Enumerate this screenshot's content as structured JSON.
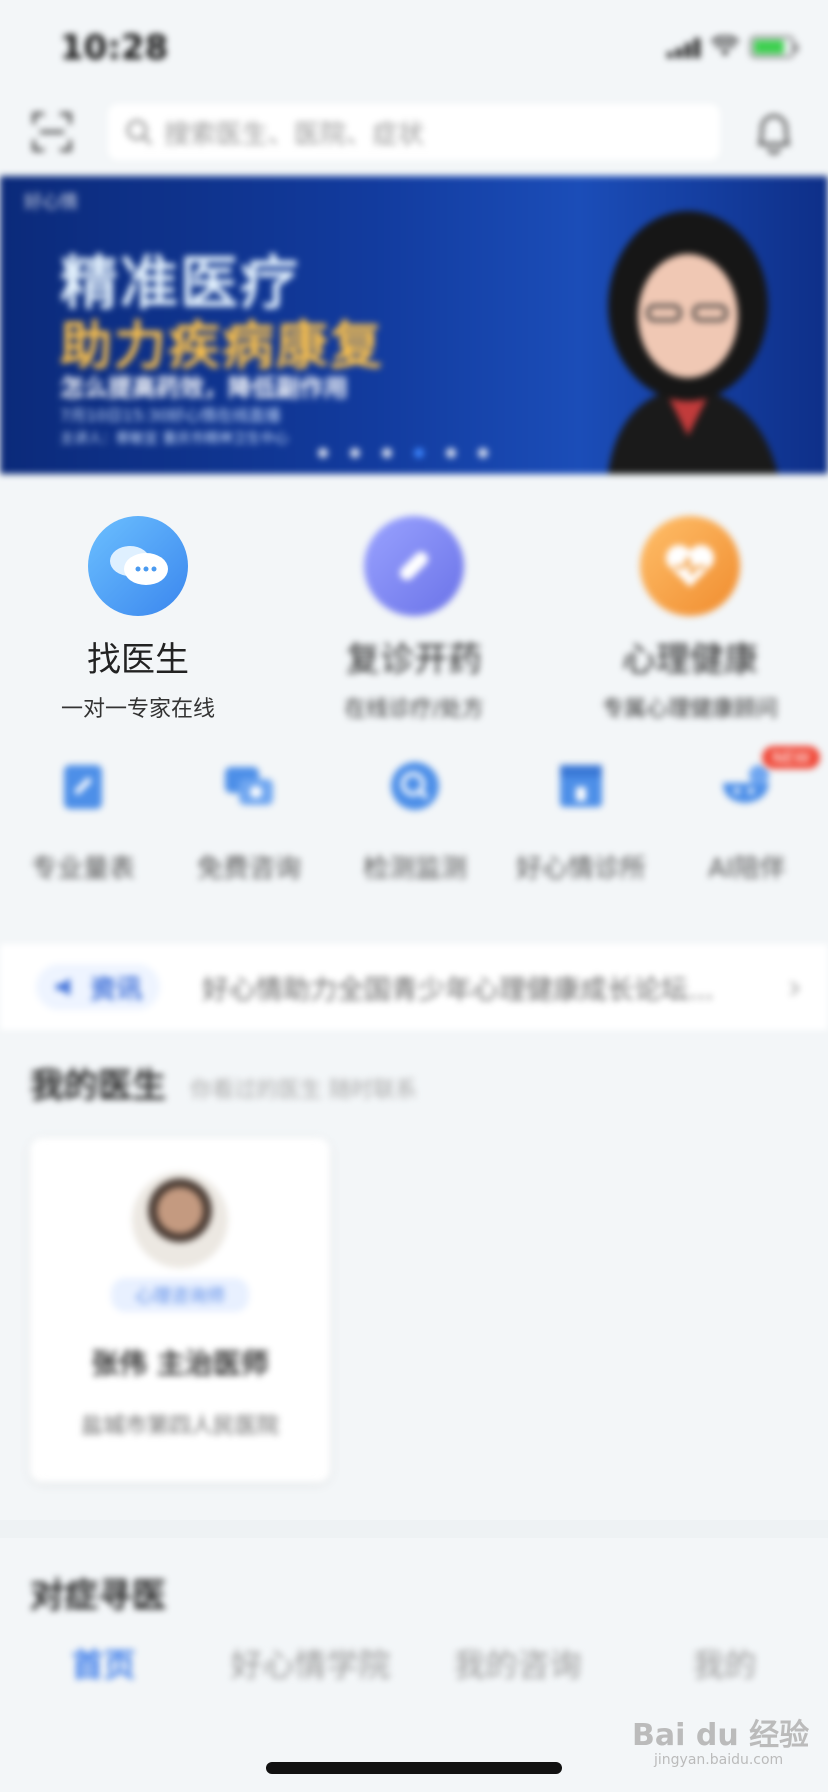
{
  "status_bar": {
    "time": "10:28"
  },
  "search": {
    "placeholder": "搜索医生、医院、症状"
  },
  "banner": {
    "logo_text": "好心情",
    "title_line1": "精准医疗",
    "title_line2": "助力疾病康复",
    "subtitle": "怎么提高药效，降低副作用",
    "detail_line1": "7月10日15:30好心情在线直播",
    "detail_line2": "主讲人：蔡敏宜 重庆市精神卫生中心",
    "dots": {
      "count": 6,
      "active_index": 3
    }
  },
  "main_services": [
    {
      "name": "找医生",
      "desc": "一对一专家在线",
      "icon": "chat-bubbles-icon",
      "color": "#4da3f5"
    },
    {
      "name": "复诊开药",
      "desc": "在线诊疗/处方",
      "icon": "pill-icon",
      "color": "#7d86f2"
    },
    {
      "name": "心理健康",
      "desc": "专属心理健康顾问",
      "icon": "heart-icon",
      "color": "#f3a34a"
    }
  ],
  "mini_services": [
    {
      "label": "专业量表",
      "icon": "clipboard-icon"
    },
    {
      "label": "免费咨询",
      "icon": "consult-icon"
    },
    {
      "label": "检测监测",
      "icon": "scan-check-icon"
    },
    {
      "label": "好心情诊所",
      "icon": "clinic-icon"
    },
    {
      "label": "AI陪伴",
      "icon": "ai-companion-icon"
    }
  ],
  "mini_badge": "NEW",
  "news": {
    "tag": "资讯",
    "text": "好心情助力全国青少年心理健康成长论坛..."
  },
  "my_doctor": {
    "title": "我的医生",
    "subtitle": "你看过的医生 随时联系",
    "doctor": {
      "tag": "心理咨询师",
      "name": "张伟  主治医师",
      "hospital": "盐城市第四人民医院"
    }
  },
  "symptom_section": {
    "title": "对症寻医"
  },
  "tabs": [
    {
      "label": "首页",
      "active": true
    },
    {
      "label": "好心情学院",
      "active": false
    },
    {
      "label": "我的咨询",
      "active": false
    },
    {
      "label": "我的",
      "active": false
    }
  ],
  "watermark": {
    "brand": "Bai du 经验",
    "url": "jingyan.baidu.com"
  },
  "colors": {
    "accent": "#3d7dea",
    "banner_bg": "#123b9e",
    "badge": "#f04a3a"
  }
}
